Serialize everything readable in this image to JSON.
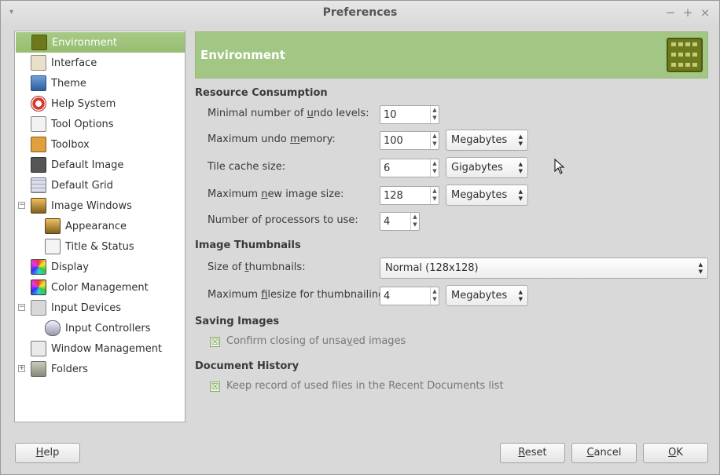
{
  "window": {
    "title": "Preferences",
    "menu_icon": "▾",
    "controls": {
      "minimize": "−",
      "maximize": "+",
      "close": "×"
    }
  },
  "sidebar": {
    "items": [
      {
        "label": "Environment",
        "icon": "chip-icon",
        "selected": true
      },
      {
        "label": "Interface",
        "icon": "interface-icon"
      },
      {
        "label": "Theme",
        "icon": "theme-icon"
      },
      {
        "label": "Help System",
        "icon": "lifebuoy-icon"
      },
      {
        "label": "Tool Options",
        "icon": "tool-options-icon"
      },
      {
        "label": "Toolbox",
        "icon": "toolbox-icon"
      },
      {
        "label": "Default Image",
        "icon": "default-image-icon"
      },
      {
        "label": "Default Grid",
        "icon": "grid-icon"
      },
      {
        "label": "Image Windows",
        "icon": "image-windows-icon",
        "expander": "−"
      },
      {
        "label": "Appearance",
        "icon": "appearance-icon"
      },
      {
        "label": "Title & Status",
        "icon": "title-status-icon"
      },
      {
        "label": "Display",
        "icon": "display-icon"
      },
      {
        "label": "Color Management",
        "icon": "color-management-icon"
      },
      {
        "label": "Input Devices",
        "icon": "input-devices-icon",
        "expander": "−"
      },
      {
        "label": "Input Controllers",
        "icon": "input-controllers-icon"
      },
      {
        "label": "Window Management",
        "icon": "window-management-icon"
      },
      {
        "label": "Folders",
        "icon": "folders-icon",
        "expander": "+"
      }
    ]
  },
  "banner": {
    "title": "Environment",
    "icon": "chip-icon"
  },
  "resource": {
    "heading": "Resource Consumption",
    "undo_levels": {
      "label_pre": "Minimal number of ",
      "label_u": "u",
      "label_post": "ndo levels:",
      "value": "10"
    },
    "undo_memory": {
      "label_pre": "Maximum undo ",
      "label_u": "m",
      "label_post": "emory:",
      "value": "100",
      "unit": "Megabytes"
    },
    "tile_cache": {
      "label": "Tile cache size:",
      "value": "6",
      "unit": "Gigabytes"
    },
    "new_image": {
      "label_pre": "Maximum ",
      "label_u": "n",
      "label_post": "ew image size:",
      "value": "128",
      "unit": "Megabytes"
    },
    "processors": {
      "label": "Number of processors to use:",
      "value": "4"
    }
  },
  "thumbnails": {
    "heading": "Image Thumbnails",
    "size": {
      "label_pre": "Size of ",
      "label_u": "t",
      "label_post": "humbnails:",
      "value": "Normal (128x128)"
    },
    "filesize": {
      "label_pre": "Maximum ",
      "label_u": "f",
      "label_post": "ilesize for thumbnailing:",
      "value": "4",
      "unit": "Megabytes"
    }
  },
  "saving": {
    "heading": "Saving Images",
    "confirm": {
      "label_pre": "Confirm closing of unsa",
      "label_u": "v",
      "label_post": "ed images",
      "checked": true
    }
  },
  "history": {
    "heading": "Document History",
    "keep": {
      "label": "Keep record of used files in the Recent Documents list",
      "checked": true
    }
  },
  "buttons": {
    "help": {
      "label_u": "H",
      "label_post": "elp"
    },
    "reset": {
      "label_u": "R",
      "label_post": "eset"
    },
    "cancel": {
      "label_u": "C",
      "label_post": "ancel"
    },
    "ok": {
      "label_u": "O",
      "label_post": "K"
    }
  },
  "colors": {
    "accent": "#9dc27c",
    "banner": "#a2c784",
    "check": "#6a9a3c"
  }
}
